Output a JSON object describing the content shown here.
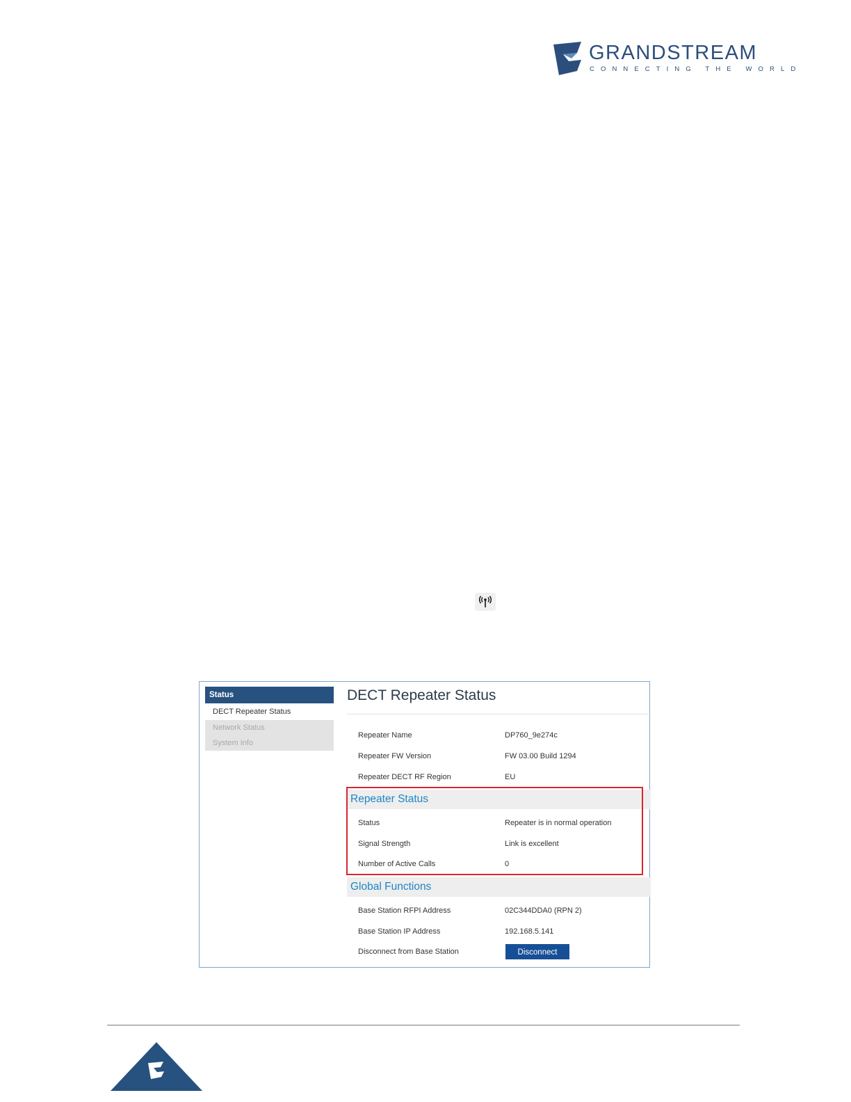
{
  "brand": {
    "name": "GRANDSTREAM",
    "tagline": "CONNECTING THE WORLD",
    "color": "#2b4e7d"
  },
  "sidebar": {
    "header": "Status",
    "items": [
      {
        "label": "DECT Repeater Status",
        "active": true
      },
      {
        "label": "Network Status",
        "active": false
      },
      {
        "label": "System Info",
        "active": false
      }
    ]
  },
  "main": {
    "title": "DECT Repeater Status",
    "info": [
      {
        "label": "Repeater Name",
        "value": "DP760_9e274c"
      },
      {
        "label": "Repeater FW Version",
        "value": "FW 03.00 Build 1294"
      },
      {
        "label": "Repeater DECT RF Region",
        "value": "EU"
      }
    ],
    "repeater_status": {
      "heading": "Repeater Status",
      "rows": [
        {
          "label": "Status",
          "value": "Repeater is in normal operation"
        },
        {
          "label": "Signal Strength",
          "value": "Link is excellent"
        },
        {
          "label": "Number of Active Calls",
          "value": "0"
        }
      ]
    },
    "global_functions": {
      "heading": "Global Functions",
      "rows": [
        {
          "label": "Base Station RFPI Address",
          "value": "02C344DDA0 (RPN 2)"
        },
        {
          "label": "Base Station IP Address",
          "value": "192.168.5.141"
        },
        {
          "label": "Disconnect from Base Station"
        }
      ],
      "disconnect_label": "Disconnect"
    }
  },
  "colors": {
    "sidebar_header": "#27517f",
    "section_heading": "#1d86c4",
    "highlight_border": "#d9262b",
    "button": "#164f96"
  }
}
